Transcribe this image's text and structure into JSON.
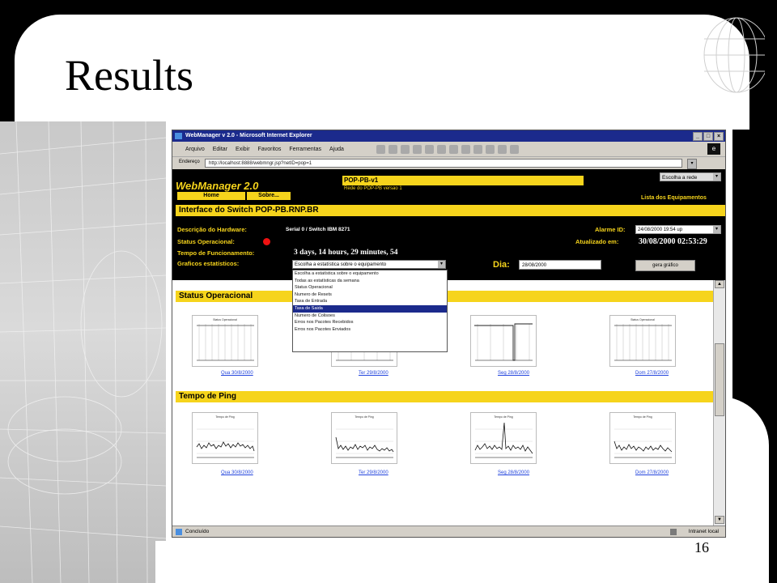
{
  "slide": {
    "title": "Results",
    "number": "16"
  },
  "window": {
    "title": "WebManager v 2.0 - Microsoft Internet Explorer",
    "menu": [
      "Arquivo",
      "Editar",
      "Exibir",
      "Favoritos",
      "Ferramentas",
      "Ajuda"
    ],
    "address_label": "Endereço",
    "address": "http://localhost:8888/webmngr.jsp?netID=pop=1"
  },
  "header": {
    "logo": "WebManager 2.0",
    "home_button": "Home",
    "sobre_button": "Sobre...",
    "pop_name": "POP-PB-v1",
    "pop_subtitle": "Rede do POP-PB versao 1",
    "escolha_rede": "Escolha a rede",
    "lista_equipamentos": "Lista dos Equipamentos"
  },
  "interface": {
    "heading": "Interface do Switch POP-PB.RNP.BR",
    "descricao_label": "Descrição do Hardware:",
    "descricao_value": "Serial 0 / Switch IBM 8271",
    "status_label": "Status Operacional:",
    "tempo_label": "Tempo de Funcionamento:",
    "tempo_value": "3 days, 14 hours, 29 minutes, 54",
    "graficos_label": "Graficos estatísticos:",
    "alarme_label": "Alarme ID:",
    "alarme_value": "24/08/2000 19:54 up",
    "atualizado_label": "Atualizado em:",
    "atualizado_value": "30/08/2000 02:53:29",
    "dia_label": "Dia:",
    "dia_value": "28/08/2000",
    "gerar_button": "gera gráfico"
  },
  "graficos_select": {
    "selected": "Escolha a estatística sobre o equipamento",
    "options": [
      "Escolha a estatística sobre o equipamento",
      "Todas as estatísticas da semana",
      "Status Operacional",
      "Numero de Resets",
      "Taxa de Entrada",
      "Taxa de Saida",
      "Numero de Colisoes",
      "Erros nos Pacotes Recebidos",
      "Erros nos Pacotes Enviados"
    ],
    "highlighted_index": 5
  },
  "sections": {
    "status": {
      "title": "Status Operacional",
      "thumb_titles": [
        "Status Operacional",
        "",
        "",
        "Status Operacional"
      ],
      "captions": [
        "Qua 30/8/2000",
        "Ter 29/8/2000",
        "Seg 28/8/2000",
        "Dom 27/8/2000"
      ]
    },
    "ping": {
      "title": "Tempo de Ping",
      "thumb_titles": [
        "Tempo de Ping",
        "Tempo de Ping",
        "Tempo de Ping",
        "Tempo de Ping"
      ],
      "captions": [
        "Qua 30/8/2000",
        "Ter 29/8/2000",
        "Seg 28/8/2000",
        "Dom 27/8/2000"
      ]
    }
  },
  "statusbar": {
    "left": "Concluído",
    "right": "Intranet local"
  },
  "colors": {
    "accent_yellow": "#f6d41c",
    "titlebar_blue": "#1b2a8c",
    "status_red": "#e11111"
  }
}
